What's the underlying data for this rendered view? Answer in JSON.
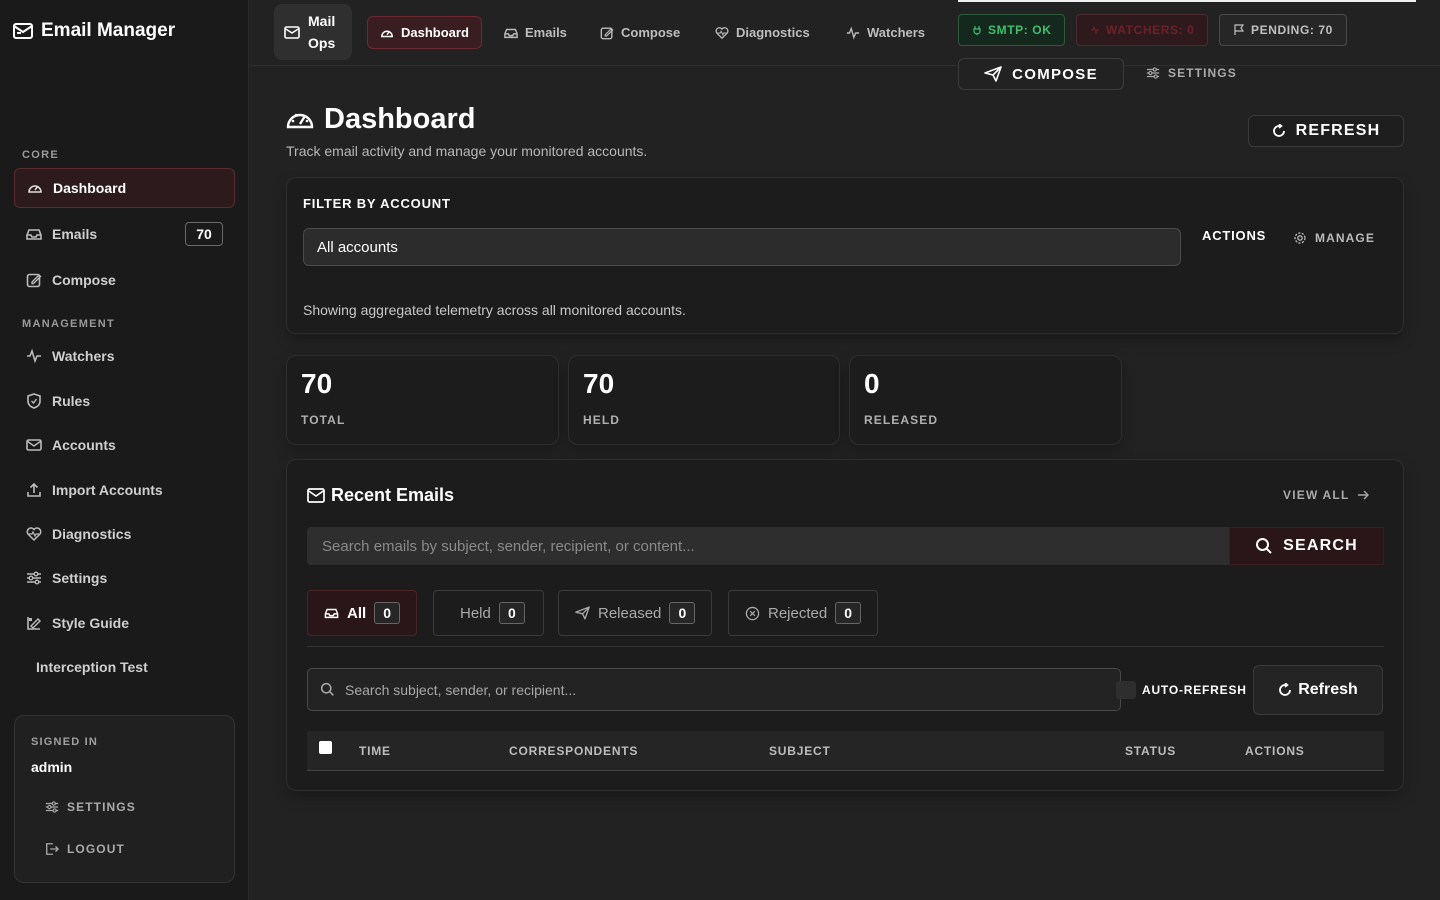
{
  "sidebar": {
    "brand": "Email Manager",
    "sections": {
      "core": "CORE",
      "management": "MANAGEMENT"
    },
    "items": [
      {
        "label": "Dashboard"
      },
      {
        "label": "Emails",
        "badge": "70"
      },
      {
        "label": "Compose"
      },
      {
        "label": "Watchers"
      },
      {
        "label": "Rules"
      },
      {
        "label": "Accounts"
      },
      {
        "label": "Import Accounts"
      },
      {
        "label": "Diagnostics"
      },
      {
        "label": "Settings"
      },
      {
        "label": "Style Guide"
      },
      {
        "label": "Interception Test"
      }
    ],
    "signin": {
      "label": "SIGNED IN",
      "user": "admin",
      "settings": "SETTINGS",
      "logout": "LOGOUT"
    }
  },
  "topbar": {
    "brand_line1": "Mail",
    "brand_line2": "Ops",
    "tabs": [
      "Dashboard",
      "Emails",
      "Compose",
      "Diagnostics",
      "Watchers"
    ],
    "status": {
      "smtp": "SMTP: OK",
      "watchers": "WATCHERS: 0",
      "pending": "PENDING: 70"
    },
    "compose": "COMPOSE",
    "settings": "SETTINGS"
  },
  "page": {
    "title": "Dashboard",
    "subtitle": "Track email activity and manage your monitored accounts.",
    "refresh": "REFRESH"
  },
  "filter": {
    "title": "FILTER BY ACCOUNT",
    "selected": "All accounts",
    "actions": "ACTIONS",
    "manage": "MANAGE",
    "note": "Showing aggregated telemetry across all monitored accounts."
  },
  "stats": [
    {
      "value": "70",
      "label": "TOTAL"
    },
    {
      "value": "70",
      "label": "HELD"
    },
    {
      "value": "0",
      "label": "RELEASED"
    }
  ],
  "recent": {
    "title": "Recent Emails",
    "view_all": "VIEW ALL",
    "search_placeholder": "Search emails by subject, sender, recipient, or content...",
    "search_button": "SEARCH",
    "tabs": [
      {
        "label": "All",
        "count": "0"
      },
      {
        "label": "Held",
        "count": "0"
      },
      {
        "label": "Released",
        "count": "0"
      },
      {
        "label": "Rejected",
        "count": "0"
      }
    ],
    "filter_placeholder": "Search subject, sender, or recipient...",
    "auto_refresh": "AUTO-REFRESH",
    "refresh": "Refresh",
    "columns": [
      "TIME",
      "CORRESPONDENTS",
      "SUBJECT",
      "STATUS",
      "ACTIONS"
    ]
  },
  "colors": {
    "accent": "#5a2a2e",
    "ok": "#3fbf6f",
    "background": "#222222"
  }
}
